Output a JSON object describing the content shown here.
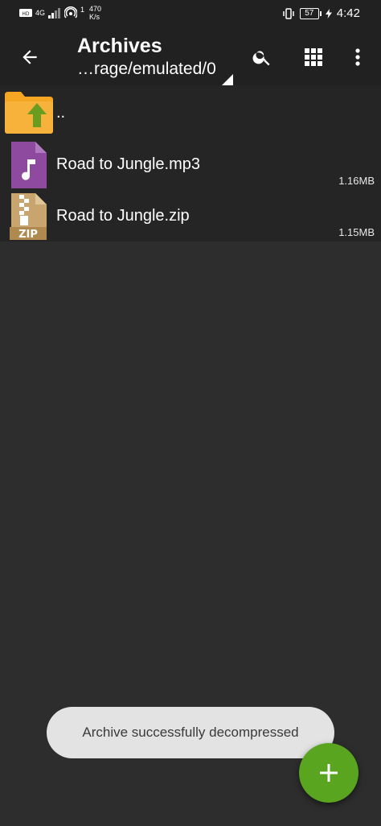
{
  "status_bar": {
    "net_type": "4G",
    "net_speed_value": "470",
    "net_speed_unit": "K/s",
    "hotspot_count": "1",
    "battery": "57",
    "time": "4:42"
  },
  "app_bar": {
    "title": "Archives",
    "path": "…rage/emulated/0"
  },
  "files": [
    {
      "name": "..",
      "size": "",
      "type": "parent-folder"
    },
    {
      "name": "Road to Jungle.mp3",
      "size": "1.16MB",
      "type": "audio"
    },
    {
      "name": "Road to Jungle.zip",
      "size": "1.15MB",
      "type": "zip"
    }
  ],
  "icons": {
    "zip_label": "ZIP"
  },
  "toast": {
    "message": "Archive successfully decompressed"
  },
  "colors": {
    "background": "#2d2d2d",
    "app_bar": "#212121",
    "fab": "#5aa520",
    "folder": "#f5a623",
    "audio": "#8e4a9e",
    "zip": "#c8a46e"
  }
}
